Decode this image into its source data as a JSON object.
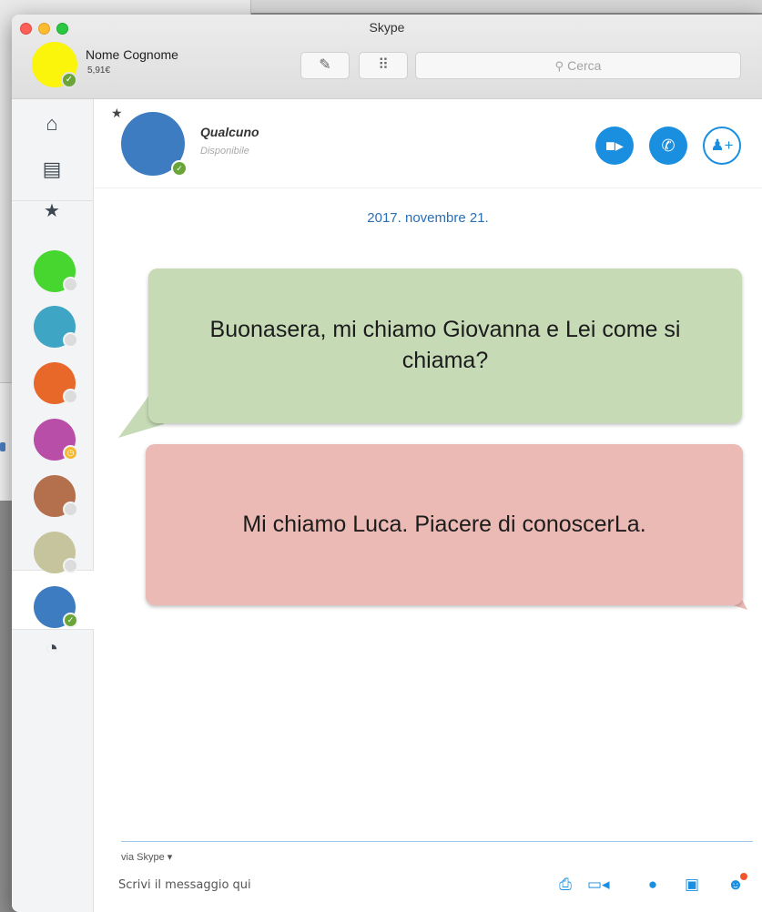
{
  "window": {
    "title": "Skype"
  },
  "profile": {
    "name": "Nome Cognome",
    "credit": "5,91€",
    "avatar_color": "#fbf40b",
    "status": "online"
  },
  "toolbar": {
    "compose_icon": "compose-icon",
    "dialpad_icon": "dialpad-icon",
    "search_placeholder": "Cerca"
  },
  "sidebar": {
    "nav": [
      {
        "name": "home-icon"
      },
      {
        "name": "contacts-icon"
      },
      {
        "name": "favorites-star-icon"
      },
      {
        "name": "recent-clock-icon"
      }
    ],
    "contacts": [
      {
        "color": "#47d630",
        "status": "offline"
      },
      {
        "color": "#3ea5c4",
        "status": "offline"
      },
      {
        "color": "#e8682a",
        "status": "offline"
      },
      {
        "color": "#b94ea8",
        "status": "away"
      },
      {
        "color": "#b46f4d",
        "status": "offline"
      },
      {
        "color": "#c5c49c",
        "status": "offline"
      },
      {
        "color": "#3e7cc1",
        "status": "online",
        "selected": true
      }
    ]
  },
  "chat": {
    "contact_name": "Qualcuno",
    "contact_status": "Disponibile",
    "contact_color": "#3e7cc1",
    "date": "2017. novembre 21.",
    "messages": [
      {
        "direction": "incoming",
        "text": "Buonasera, mi chiamo Giovanna e Lei come si chiama?",
        "color": "#c6dab6"
      },
      {
        "direction": "outgoing",
        "text": "Mi chiamo Luca. Piacere di conoscerLa.",
        "color": "#ecbab5"
      }
    ]
  },
  "composer": {
    "via": "via Skype ▾",
    "placeholder": "Scrivi il messaggio qui",
    "tools": [
      "send-file-icon",
      "video-message-icon",
      "location-icon",
      "contact-card-icon",
      "emoticon-icon"
    ]
  },
  "colors": {
    "accent": "#1a8fe0",
    "online": "#6ba53a",
    "away": "#f5b82e"
  }
}
